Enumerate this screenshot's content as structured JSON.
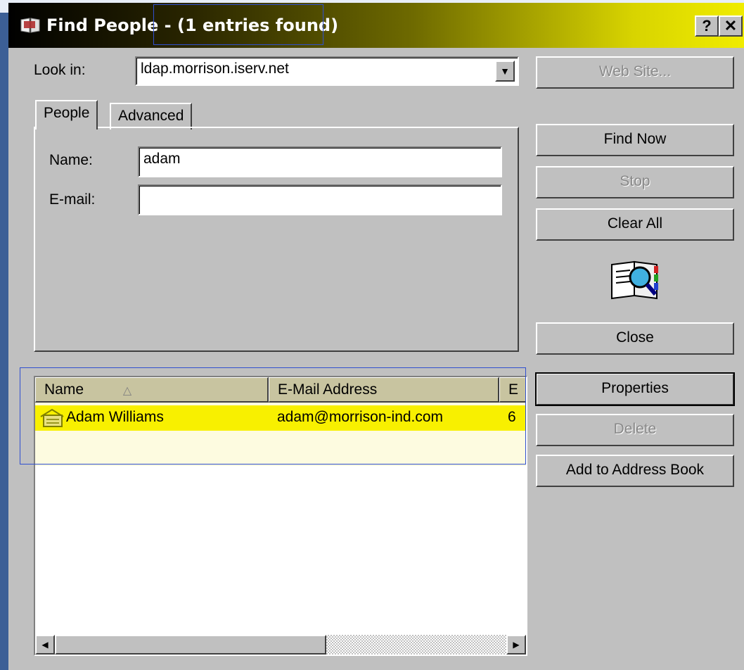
{
  "window": {
    "title": "Find People -",
    "result_count": "(1 entries found)",
    "help_label": "?",
    "close_label": "✕"
  },
  "look_in": {
    "label": "Look in:",
    "value": "ldap.morrison.iserv.net"
  },
  "tabs": [
    {
      "label": "People",
      "active": true
    },
    {
      "label": "Advanced",
      "active": false
    }
  ],
  "form": {
    "name_label": "Name:",
    "name_value": "adam",
    "email_label": "E-mail:",
    "email_value": ""
  },
  "buttons": {
    "web_site": "Web Site...",
    "find_now": "Find Now",
    "stop": "Stop",
    "clear_all": "Clear All",
    "close": "Close",
    "properties": "Properties",
    "delete": "Delete",
    "add_to_address_book": "Add to Address Book"
  },
  "results": {
    "columns": [
      "Name",
      "E-Mail Address",
      "E"
    ],
    "sort_indicator": "△",
    "rows": [
      {
        "name": "Adam Williams",
        "email": "adam@morrison-ind.com",
        "extra": "6"
      }
    ]
  },
  "colors": {
    "selected_row": "#f8f000",
    "dialog_face": "#c0c0c0",
    "title_gradient_end": "#f0ec00"
  },
  "icons": [
    "address-book-icon",
    "find-people-search-icon",
    "contact-card-icon"
  ]
}
